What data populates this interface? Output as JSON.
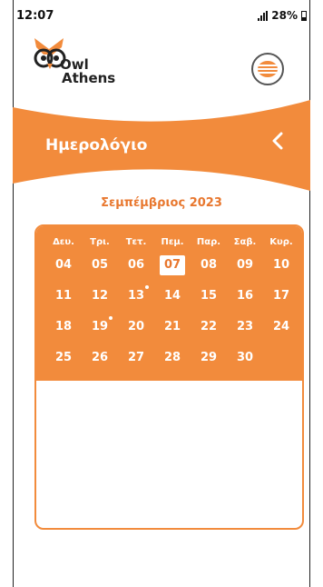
{
  "status": {
    "time": "12:07",
    "battery": "28%"
  },
  "brand": {
    "line1": "Owl",
    "line2": "Athens"
  },
  "header": {
    "title": "Ημερολόγιο"
  },
  "calendar": {
    "month_label": "Σεμπέμβριος  2023",
    "weekdays": [
      "Δευ.",
      "Τρι.",
      "Τετ.",
      "Πεμ.",
      "Παρ.",
      "Σαβ.",
      "Κυρ."
    ],
    "selected_day": "07",
    "days_with_events": [
      "13",
      "19"
    ],
    "rows": [
      [
        "04",
        "05",
        "06",
        "07",
        "08",
        "09",
        "10"
      ],
      [
        "11",
        "12",
        "13",
        "14",
        "15",
        "16",
        "17"
      ],
      [
        "18",
        "19",
        "20",
        "21",
        "22",
        "23",
        "24"
      ],
      [
        "25",
        "26",
        "27",
        "28",
        "29",
        "30",
        ""
      ]
    ]
  },
  "colors": {
    "accent": "#f28b3c",
    "accent_text": "#e8772e",
    "text": "#111111"
  }
}
